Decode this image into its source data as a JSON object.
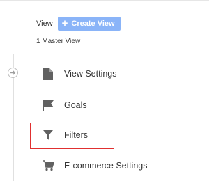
{
  "header": {
    "view_label": "View",
    "create_button": {
      "icon": "plus-icon",
      "label": "Create View"
    },
    "master_view_count": "1 Master View"
  },
  "menu": {
    "items": [
      {
        "label": "View Settings",
        "icon": "document-icon"
      },
      {
        "label": "Goals",
        "icon": "flag-icon"
      },
      {
        "label": "Filters",
        "icon": "filter-icon"
      },
      {
        "label": "E-commerce Settings",
        "icon": "cart-icon"
      }
    ],
    "highlighted_item": "Filters"
  },
  "colors": {
    "create_button_bg": "#8ab4f8",
    "highlight_border": "#e03030",
    "icon_color": "#616161",
    "text_color": "#333333"
  }
}
